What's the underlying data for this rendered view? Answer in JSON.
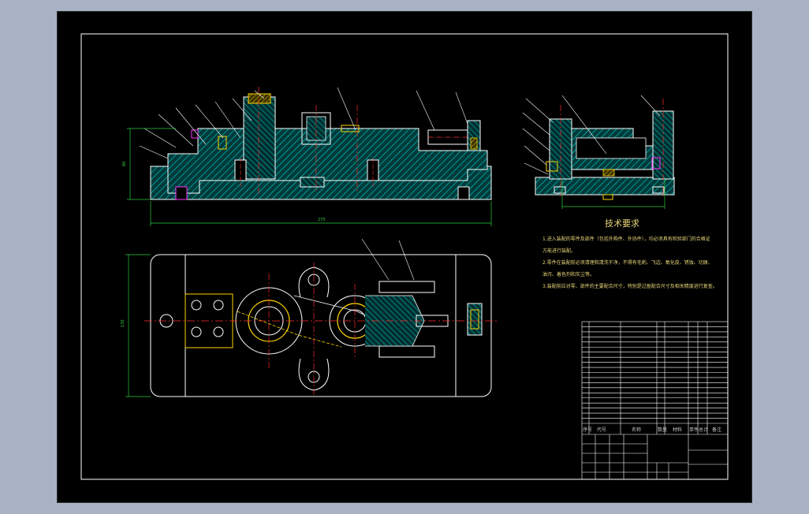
{
  "colors": {
    "background": "#000000",
    "frame": "#ffffff",
    "part_outline": "#ffffff",
    "hatch": "#00a3a3",
    "centerline": "#ff3030",
    "dimension": "#2ecc40",
    "accent_yellow": "#ffd400",
    "accent_magenta": "#ff33ff",
    "note_text": "#e8d67a",
    "title_text": "#c7c7c7"
  },
  "drawing": {
    "tech_req_title": "技术要求",
    "tech_req_lines": [
      "1.进入装配的零件及部件（包括外购件、外协件），均必须具有检验部门的合格证",
      "方能进行装配。",
      "2.零件在装配前必须清理和清洗干净，不得有毛刺、飞边、氧化皮、锈蚀、切屑、",
      "油污、着色剂和灰尘等。",
      "3.装配前应对零、部件的主要配合尺寸，特别是过盈配合尺寸及相关精度进行复查。"
    ],
    "overall_dim_label": "270",
    "height_dim_label": "80",
    "plan_width_label": "130"
  },
  "title_block": {
    "header": [
      "序号",
      "代号",
      "名称",
      "数量",
      "材料",
      "单件",
      "总计",
      "备注"
    ],
    "rows_count": 20
  }
}
